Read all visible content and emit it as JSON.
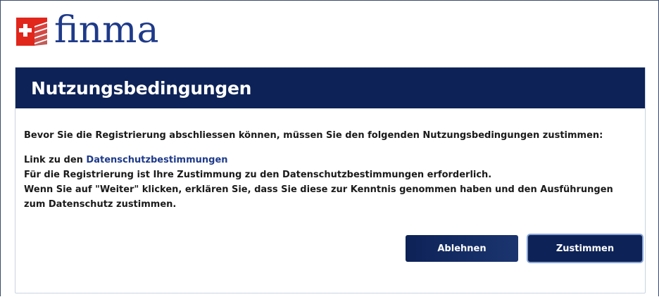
{
  "brand": {
    "name": "finma",
    "accent_color": "#1e3a8a",
    "flag_color": "#e1261c"
  },
  "dialog": {
    "title": "Nutzungsbedingungen",
    "intro": "Bevor Sie die Registrierung abschliessen können, müssen Sie den folgenden Nutzungsbedingungen zustimmen:",
    "link_prefix": "Link zu den ",
    "link_label": "Datenschutzbestimmungen",
    "consent_line": "Für die Registrierung ist Ihre Zustimmung zu den Datenschutzbestimmungen erforderlich.",
    "info_text": "Wenn Sie auf \"Weiter\" klicken, erklären Sie, dass Sie diese zur Kenntnis genommen haben und den Ausführungen zum Datenschutz zustimmen.",
    "header_color": "#0d2257"
  },
  "buttons": {
    "decline_label": "Ablehnen",
    "accept_label": "Zustimmen"
  }
}
